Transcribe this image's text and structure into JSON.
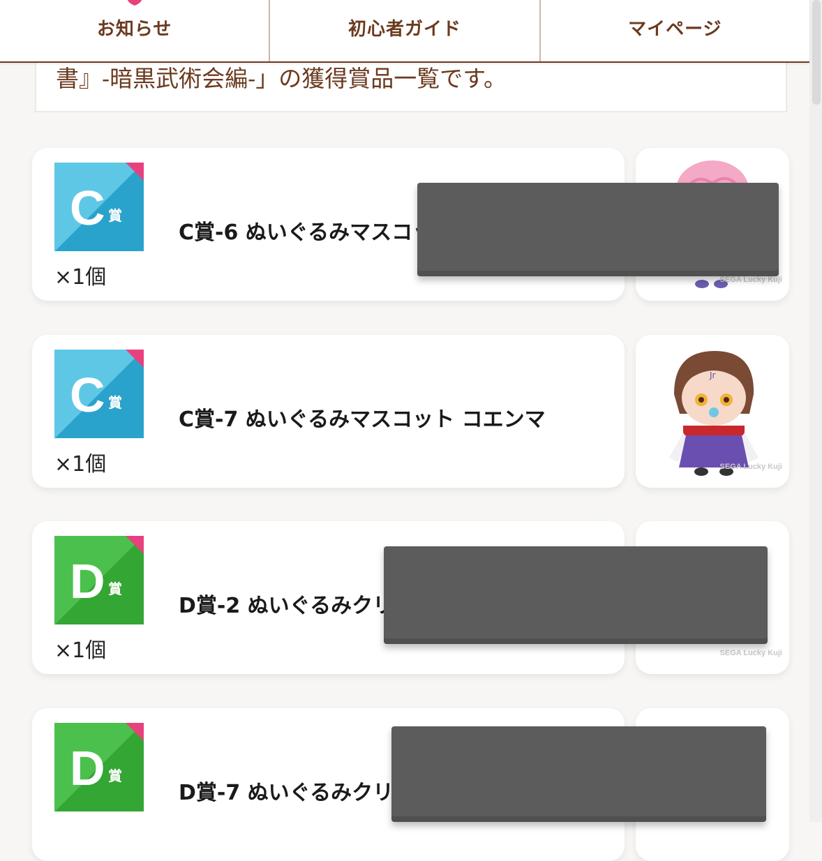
{
  "nav": {
    "items": [
      {
        "label": "お知らせ",
        "icon": "bell-icon"
      },
      {
        "label": "初心者ガイド",
        "icon": "guide-icon"
      },
      {
        "label": "マイページ",
        "icon": "person-icon"
      }
    ]
  },
  "intro": {
    "text": "書』-暗黒武術会編-」の獲得賞品一覧です。"
  },
  "prizes": [
    {
      "grade": "C",
      "grade_kanji": "賞",
      "name": "C賞-6 ぬいぐるみマスコッ",
      "quantity": "×1個",
      "badge_color": "#2aa6cf"
    },
    {
      "grade": "C",
      "grade_kanji": "賞",
      "name": "C賞-7 ぬいぐるみマスコット コエンマ",
      "quantity": "×1個",
      "badge_color": "#2aa6cf"
    },
    {
      "grade": "D",
      "grade_kanji": "賞",
      "name": "D賞-2 ぬいぐるみクリ",
      "quantity": "×1個",
      "badge_color": "#3aae3a"
    },
    {
      "grade": "D",
      "grade_kanji": "賞",
      "name": "D賞-7 ぬいぐるみクリ",
      "quantity": "",
      "badge_color": "#3aae3a"
    }
  ],
  "watermark": "SEGA Lucky Kuji",
  "colors": {
    "brand_brown": "#6b3a1f",
    "accent_pink": "#e8417d",
    "c_badge": "#2aa6cf",
    "d_badge": "#3aae3a",
    "redaction": "#5c5c5c"
  }
}
